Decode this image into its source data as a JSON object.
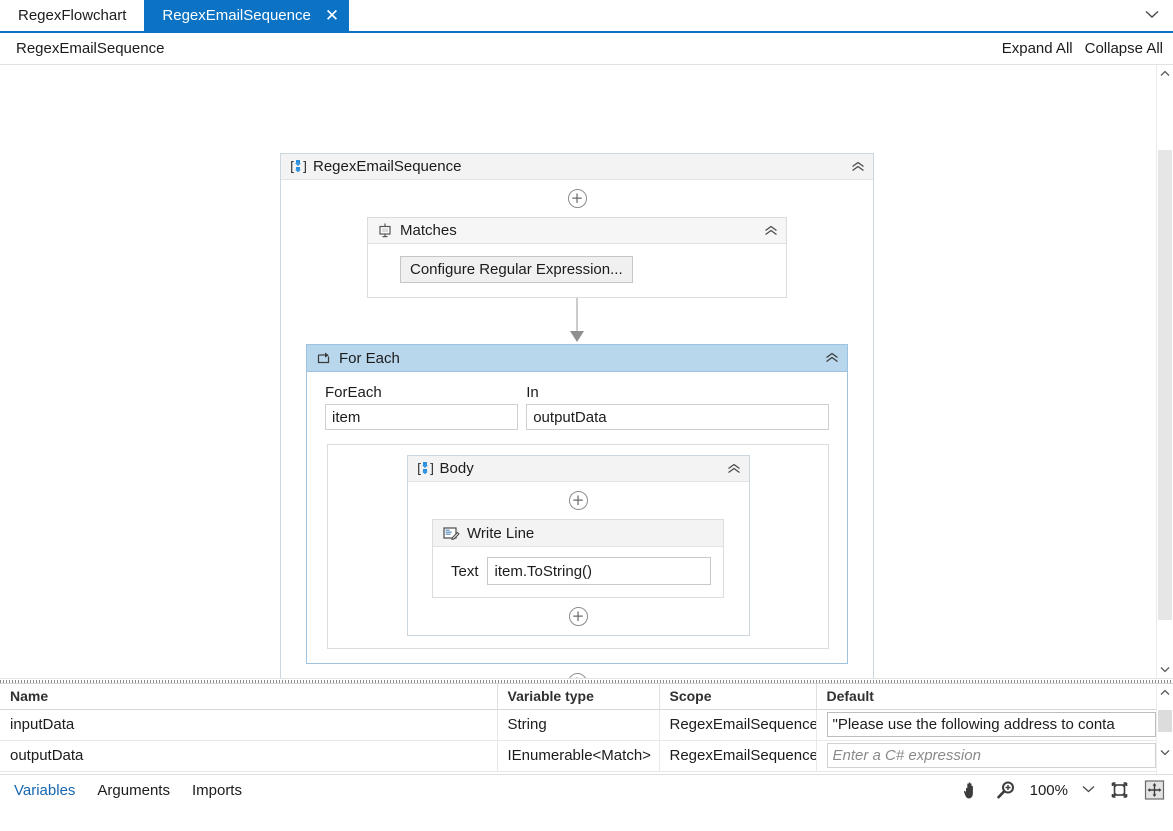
{
  "tabs": [
    {
      "label": "RegexFlowchart",
      "active": false,
      "closable": false
    },
    {
      "label": "RegexEmailSequence",
      "active": true,
      "closable": true,
      "close_glyph": "✕"
    }
  ],
  "tabstrip": {
    "overflow_chevron": "∨"
  },
  "breadcrumb": {
    "text": "RegexEmailSequence",
    "expand_all": "Expand All",
    "collapse_all": "Collapse All"
  },
  "canvas": {
    "root": {
      "title": "RegexEmailSequence",
      "icon": "sequence-icon",
      "collapse_glyph": "«",
      "plus_glyph": "+"
    },
    "matches": {
      "title": "Matches",
      "icon": "matches-icon",
      "collapse_glyph": "«",
      "button_label": "Configure Regular Expression..."
    },
    "foreach": {
      "title": "For Each",
      "icon": "foreach-icon",
      "collapse_glyph": "«",
      "foreach_label": "ForEach",
      "foreach_value": "item",
      "in_label": "In",
      "in_value": "outputData"
    },
    "body": {
      "title": "Body",
      "icon": "sequence-icon",
      "collapse_glyph": "«"
    },
    "writeline": {
      "title": "Write Line",
      "icon": "write-line-icon",
      "text_label": "Text",
      "text_value": "item.ToString()"
    }
  },
  "variables_panel": {
    "columns": [
      "Name",
      "Variable type",
      "Scope",
      "Default"
    ],
    "rows": [
      {
        "name": "inputData",
        "type": "String",
        "scope": "RegexEmailSequence",
        "default": "\"Please use the following address to conta",
        "default_is_placeholder": false
      },
      {
        "name": "outputData",
        "type": "IEnumerable<Match>",
        "scope": "RegexEmailSequence",
        "default": "Enter a C# expression",
        "default_is_placeholder": true
      }
    ]
  },
  "statusbar": {
    "tabs": [
      {
        "label": "Variables",
        "active": true
      },
      {
        "label": "Arguments",
        "active": false
      },
      {
        "label": "Imports",
        "active": false
      }
    ],
    "pan_icon": "hand-icon",
    "zoom_icon": "magnifier-icon",
    "zoom_value": "100%",
    "zoom_chevron": "∨",
    "fit_to_screen_icon": "fit-to-screen-icon",
    "overview_icon": "overview-icon"
  },
  "colors": {
    "tab_active": "#0b72c4",
    "foreach_header": "#b8d6ec",
    "accent_link": "#1566b0"
  }
}
